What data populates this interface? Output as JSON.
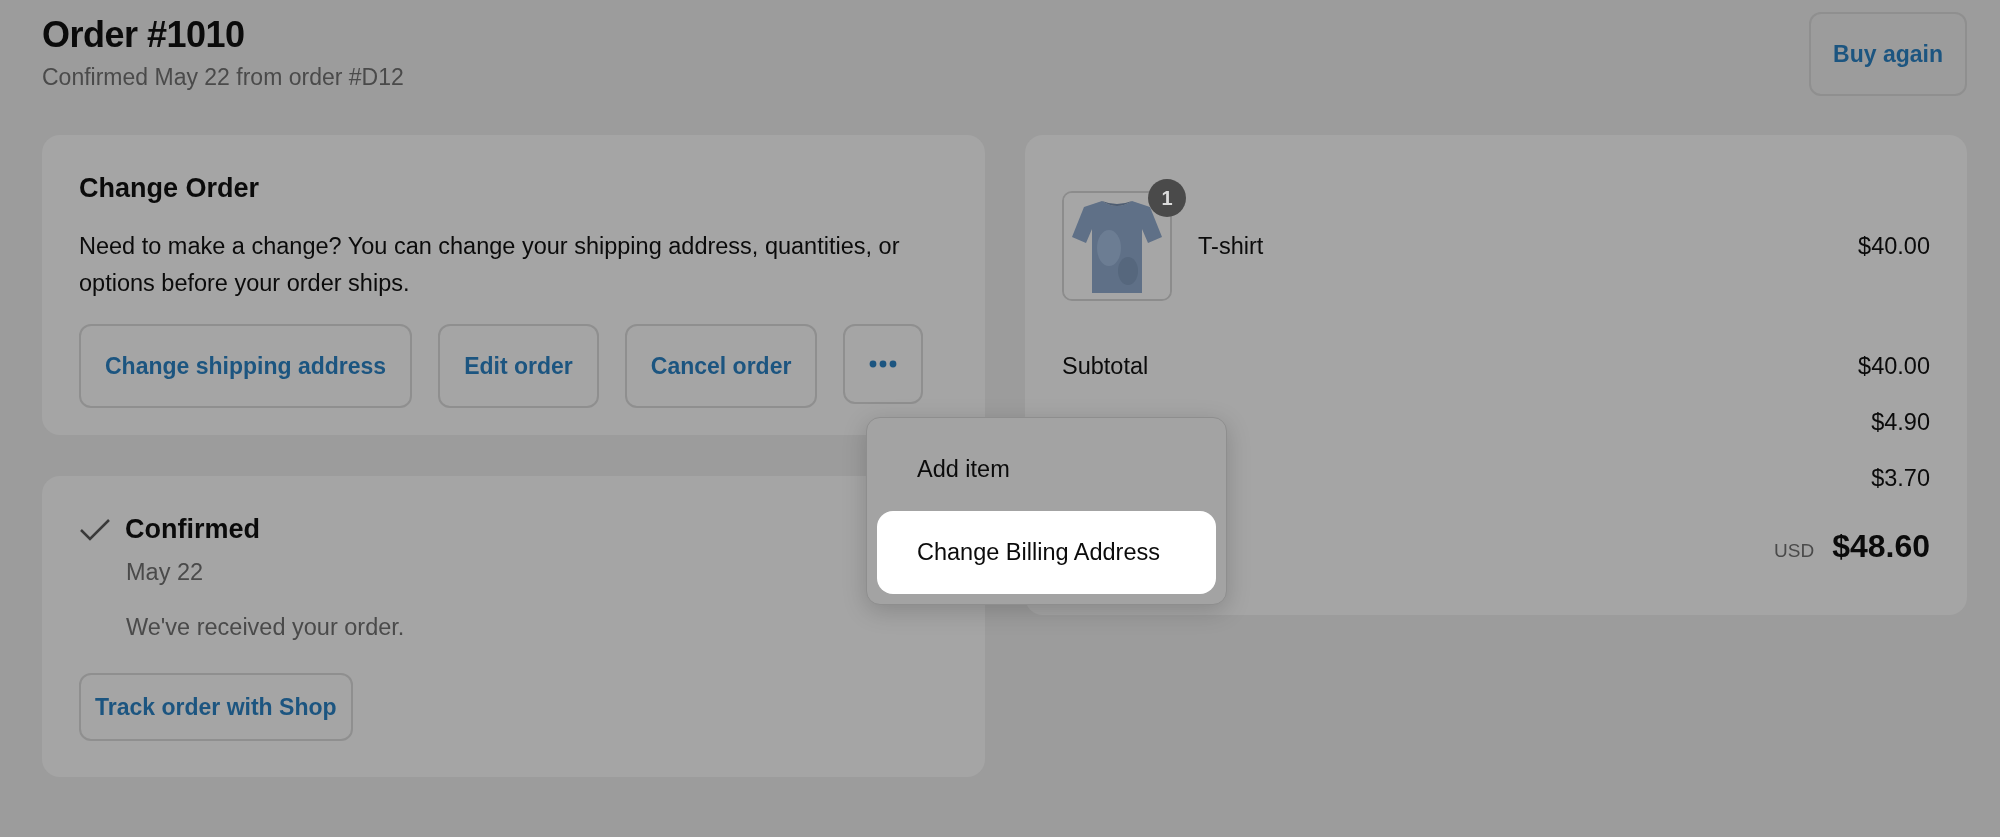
{
  "header": {
    "title": "Order #1010",
    "subtitle": "Confirmed May 22 from order #D12",
    "button": "Buy again"
  },
  "change_order": {
    "title": "Change Order",
    "description": "Need to make a change? You can change your shipping address, quantities, or options before your order ships.",
    "buttons": [
      "Change shipping address",
      "Edit order",
      "Cancel order"
    ]
  },
  "more_menu": {
    "items": [
      {
        "label": "Add item",
        "selected": false
      },
      {
        "label": "Change Billing Address",
        "selected": true
      }
    ]
  },
  "status": {
    "title": "Confirmed",
    "date": "May 22",
    "message": "We've received your order.",
    "button": "Track order with Shop"
  },
  "summary": {
    "items": [
      {
        "kind": "picture",
        "name": "T-shirt",
        "quantity": "1",
        "price": "$40.00"
      }
    ],
    "lines": [
      {
        "label": "Subtotal",
        "amount": "$40.00"
      },
      {
        "amount": "$4.90"
      },
      {
        "amount": "$3.70"
      }
    ],
    "total": {
      "currency": "USD",
      "amount": "$48.60"
    }
  }
}
